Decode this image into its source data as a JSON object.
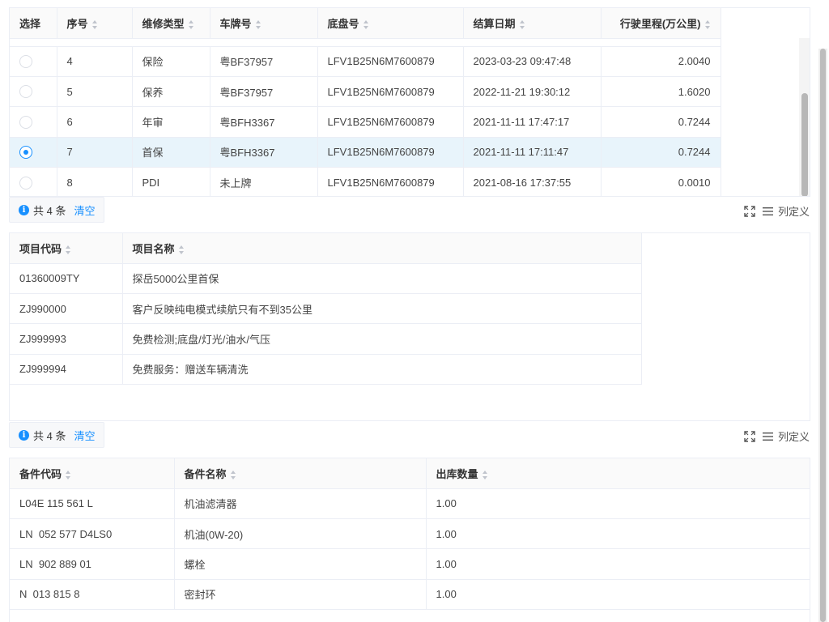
{
  "orders_table": {
    "columns": [
      "选择",
      "序号",
      "维修类型",
      "车牌号",
      "底盘号",
      "结算日期",
      "行驶里程(万公里)"
    ],
    "rows": [
      {
        "selected": false,
        "no": "4",
        "type": "保险",
        "plate": "粤BF37957",
        "vin": "LFV1B25N6M7600879",
        "date": "2023-03-23 09:47:48",
        "mileage": "2.0040"
      },
      {
        "selected": false,
        "no": "5",
        "type": "保养",
        "plate": "粤BF37957",
        "vin": "LFV1B25N6M7600879",
        "date": "2022-11-21 19:30:12",
        "mileage": "1.6020"
      },
      {
        "selected": false,
        "no": "6",
        "type": "年审",
        "plate": "粤BFH3367",
        "vin": "LFV1B25N6M7600879",
        "date": "2021-11-11 17:47:17",
        "mileage": "0.7244"
      },
      {
        "selected": true,
        "no": "7",
        "type": "首保",
        "plate": "粤BFH3367",
        "vin": "LFV1B25N6M7600879",
        "date": "2021-11-11 17:11:47",
        "mileage": "0.7244"
      },
      {
        "selected": false,
        "no": "8",
        "type": "PDI",
        "plate": "未上牌",
        "vin": "LFV1B25N6M7600879",
        "date": "2021-08-16 17:37:55",
        "mileage": "0.0010"
      }
    ]
  },
  "items_summary": {
    "info": "i",
    "count": "共 4 条",
    "clear": "清空"
  },
  "items_tools": {
    "settings": "列定义"
  },
  "items_table": {
    "columns": [
      "项目代码",
      "项目名称"
    ],
    "rows": [
      {
        "code": "01360009TY",
        "name": "探岳5000公里首保"
      },
      {
        "code": "ZJ990000",
        "name": "客户反映纯电模式续航只有不到35公里"
      },
      {
        "code": "ZJ999993",
        "name": "免费检测;底盘/灯光/油水/气压"
      },
      {
        "code": "ZJ999994",
        "name": "免费服务：赠送车辆清洗"
      }
    ]
  },
  "parts_summary": {
    "info": "i",
    "count": "共 4 条",
    "clear": "清空"
  },
  "parts_tools": {
    "settings": "列定义"
  },
  "parts_table": {
    "columns": [
      "备件代码",
      "备件名称",
      "出库数量"
    ],
    "rows": [
      {
        "code": "L04E 115 561 L",
        "name": "机油滤清器",
        "qty": "1.00"
      },
      {
        "code": "LN  052 577 D4LS0",
        "name": "机油(0W-20)",
        "qty": "1.00"
      },
      {
        "code": "LN  902 889 01",
        "name": "螺栓",
        "qty": "1.00"
      },
      {
        "code": "N  013 815 8",
        "name": "密封环",
        "qty": "1.00"
      }
    ]
  },
  "colors": {
    "accent": "#1890ff",
    "selected_row": "#e8f4fb",
    "header_bg": "#fafafa",
    "border": "#ebeef5"
  },
  "icons": [
    "info-icon",
    "fullscreen-icon",
    "list-icon",
    "radio-icon",
    "sort-icon"
  ]
}
